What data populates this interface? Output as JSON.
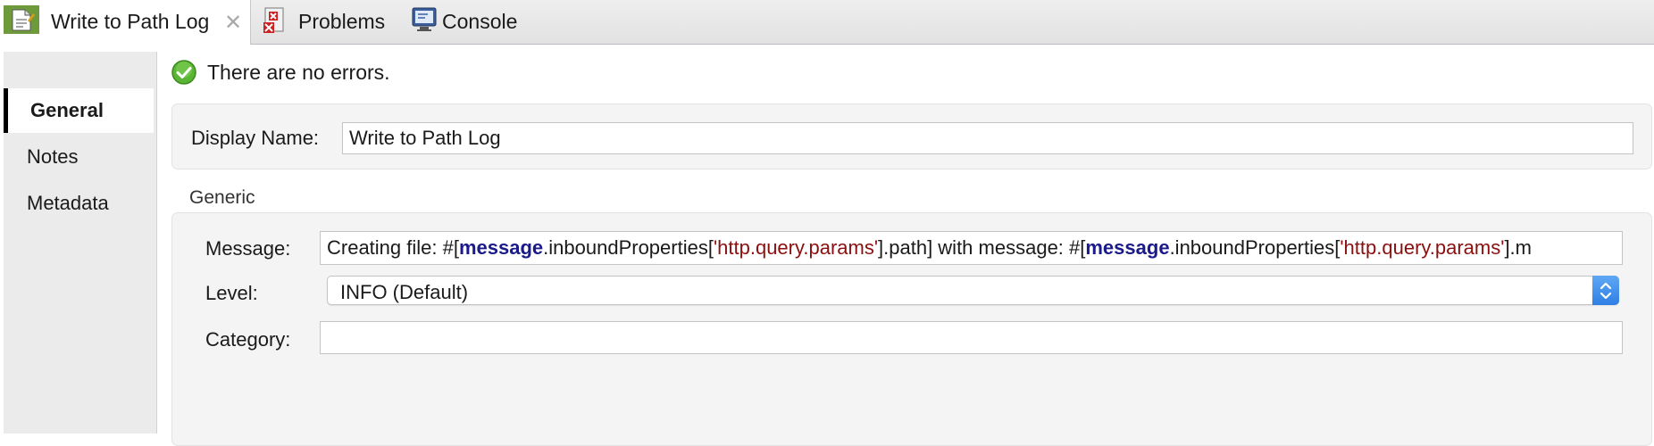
{
  "tabs": [
    {
      "label": "Write to Path Log",
      "icon": "logger-icon",
      "closable": true
    },
    {
      "label": "Problems",
      "icon": "problems-icon"
    },
    {
      "label": "Console",
      "icon": "console-icon"
    }
  ],
  "nav": [
    {
      "label": "General",
      "active": true
    },
    {
      "label": "Notes"
    },
    {
      "label": "Metadata"
    }
  ],
  "status": {
    "text": "There are no errors.",
    "icon": "check-circle-icon"
  },
  "display_name": {
    "label": "Display Name:",
    "value": "Write to Path Log"
  },
  "generic": {
    "title": "Generic",
    "message_label": "Message:",
    "message_parts": [
      "Creating file: #[",
      "message",
      ".inboundProperties[",
      "'http.query.params'",
      "].path] with message: #[",
      "message",
      ".inboundProperties[",
      "'http.query.params'",
      "].m"
    ],
    "level_label": "Level:",
    "level_value": "INFO (Default)",
    "category_label": "Category:",
    "category_value": ""
  },
  "colors": {
    "keyword": "#1a1a8a",
    "string": "#8b0f0f",
    "accent": "#2f7fe4"
  }
}
